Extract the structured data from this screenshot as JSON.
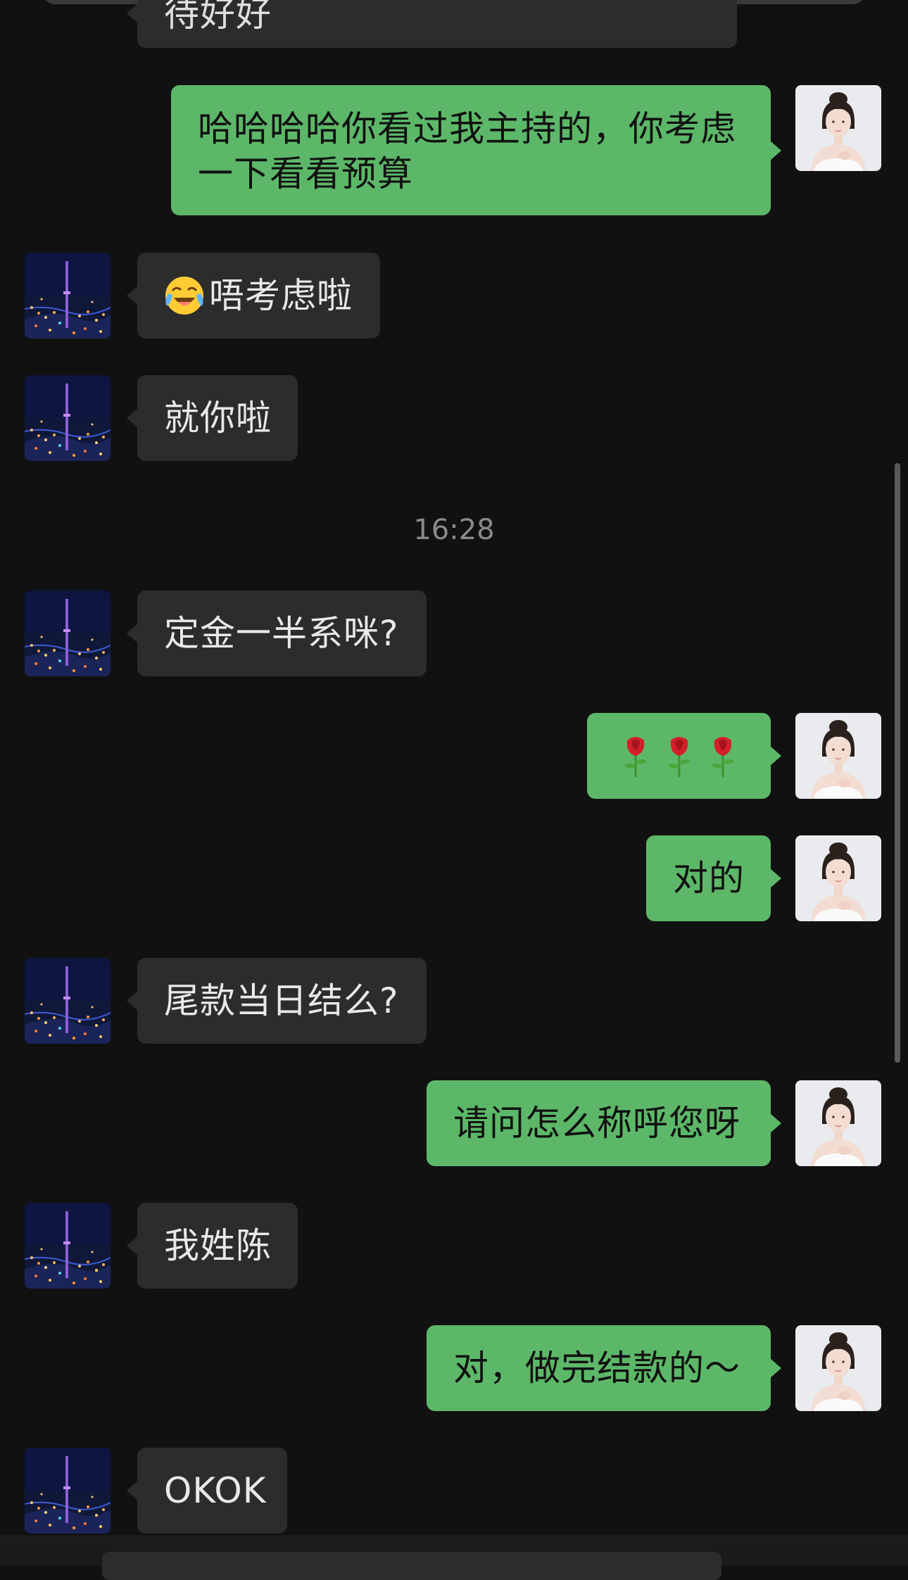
{
  "colors": {
    "background": "#111111",
    "incoming_bubble": "#2c2c2c",
    "outgoing_bubble": "#5cb868",
    "timestamp": "#8a8a8a"
  },
  "messages": [
    {
      "side": "in",
      "text": "待好好",
      "partial": true
    },
    {
      "side": "out",
      "text": "哈哈哈哈你看过我主持的，你考虑一下看看预算"
    },
    {
      "side": "in",
      "text": "唔考虑啦",
      "prefix_icon": "crying-laughing-face-emoji"
    },
    {
      "side": "in",
      "text": "就你啦"
    },
    {
      "side": "in",
      "text": "定金一半系咪?"
    },
    {
      "side": "out",
      "text": "",
      "icons": [
        "rose-emoji",
        "rose-emoji",
        "rose-emoji"
      ]
    },
    {
      "side": "out",
      "text": "对的"
    },
    {
      "side": "in",
      "text": "尾款当日结么?"
    },
    {
      "side": "out",
      "text": "请问怎么称呼您呀"
    },
    {
      "side": "in",
      "text": "我姓陈"
    },
    {
      "side": "out",
      "text": "对，做完结款的～"
    },
    {
      "side": "in",
      "text": "OKOK"
    }
  ],
  "timestamp": "16:28",
  "avatars": {
    "incoming": "city-night-tower-avatar",
    "outgoing": "woman-portrait-avatar"
  }
}
